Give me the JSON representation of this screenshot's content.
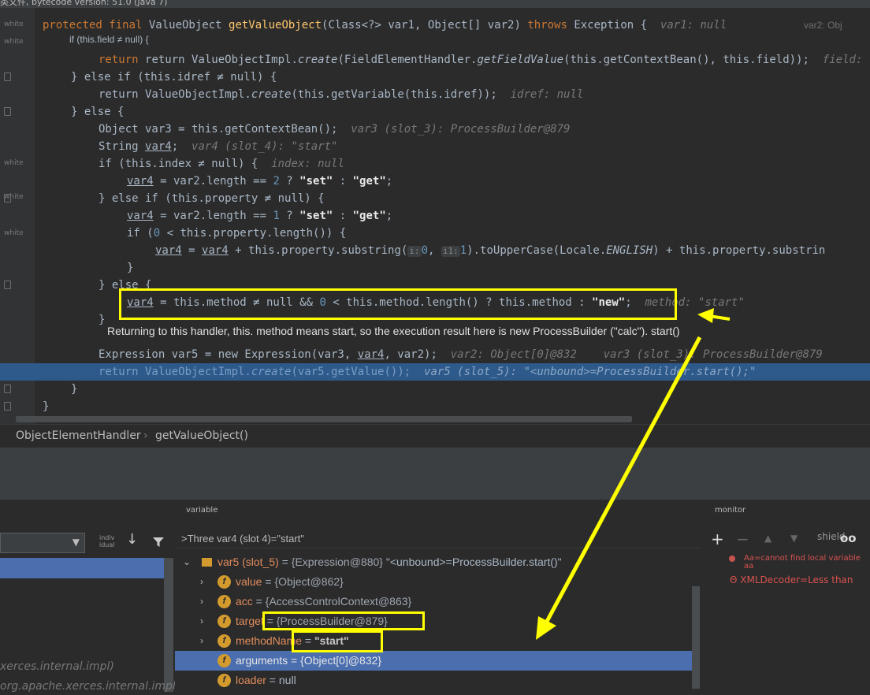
{
  "top_title": "类文件, bytecode version: 51.0 (Java 7)",
  "gutter_labels": [
    "white",
    "white",
    "white",
    "white",
    "white"
  ],
  "code": {
    "sig": {
      "kw1": "protected final ",
      "type": "ValueObject ",
      "fn": "getValueObject",
      "params": "(Class<?> var1, Object[] var2) ",
      "throws": "throws ",
      "exc": "Exception {",
      "hint1": "var1: null",
      "hint2": "var2: Obj"
    },
    "l2": "if (this.field ≠ null) {",
    "l3": {
      "a": "return ValueObjectImpl.",
      "b": "create",
      "c": "(FieldElementHandler.",
      "d": "getFieldValue",
      "e": "(this.getContextBean(), this.field));",
      "hint": "field:"
    },
    "l4": {
      "a": "} else if (this.idref ≠ null) {"
    },
    "l5": {
      "a": "return ValueObjectImpl.",
      "b": "create",
      "c": "(this.getVariable(this.idref));",
      "hint": "idref: null"
    },
    "l6": "} else {",
    "l7": {
      "a": "Object var3 = this.getContextBean();",
      "hint": "var3 (slot_3): ProcessBuilder@879"
    },
    "l8": {
      "a": "String ",
      "b": "var4",
      ";": ";",
      "hint": "var4 (slot_4): \"start\""
    },
    "l9": {
      "a": "if (this.index ≠ null) {",
      "hint": "index: null"
    },
    "l10": {
      "v": "var4",
      "a": " = var2.length == ",
      "n": "2",
      "b": " ? ",
      "s1": "\"set\"",
      "c": " : ",
      "s2": "\"get\"",
      "d": ";"
    },
    "l11": {
      "a": "} else if (this.property ≠ null) {"
    },
    "l12": {
      "v": "var4",
      "a": " = var2.length == ",
      "n": "1",
      "b": " ? ",
      "s1": "\"set\"",
      "c": " : ",
      "s2": "\"get\"",
      "d": ";"
    },
    "l13": {
      "a": "if (",
      "n": "0",
      "b": " < this.property.length()) {"
    },
    "l14": {
      "v1": "var4",
      "a": " = ",
      "v2": "var4",
      "b": " + this.property.substring(",
      "p1": "i:",
      "n1": "0",
      ",": ", ",
      "p2": "i1:",
      "n2": "1",
      "c": ").toUpperCase(Locale.",
      "e": "ENGLISH",
      "d": ") + this.property.substrin"
    },
    "l15": "}",
    "l16": "} else {",
    "l17": {
      "v": "var4",
      "a": " = this.method ≠ null && ",
      "n": "0",
      "b": " < this.method.length() ? this.method : ",
      "s": "\"new\"",
      "c": ";",
      "hint": "method: \"start\""
    },
    "l18": "}",
    "l19": {
      "a": "Expression var5 = new Expression(var3, ",
      "v": "var4",
      ",": ", var2);",
      "hint": "var2: Object[0]@832    var3 (slot_3): ProcessBuilder@879"
    },
    "l20": {
      "a": "return ValueObjectImpl.",
      "b": "create",
      "c": "(var5.getValue());",
      "hint": "var5 (slot_5): \"<unbound>=ProcessBuilder.start();\""
    },
    "l21": "}",
    "l22": "}"
  },
  "annotation": "Returning to this handler, this. method means start, so the execution result here is new ProcessBuilder (\"calc\"). start()",
  "breadcrumb": {
    "class": "ObjectElementHandler",
    "method": "getValueObject()"
  },
  "frames": {
    "partial1": "xerces.internal.impl)",
    "partial2": "org.apache.xerces.internal.impl)",
    "small_label": "indiv idual"
  },
  "variables": {
    "title": "variable",
    "eval": ">Three var4 (slot 4)=\"start\"",
    "rows": [
      {
        "name": "var5 (slot_5)",
        "eq": " = ",
        "val": "{Expression@880}",
        "extra": " \"<unbound>=ProcessBuilder.start()\""
      },
      {
        "name": "value",
        "eq": " = ",
        "val": "{Object@862}"
      },
      {
        "name": "acc",
        "eq": " = ",
        "val": "{AccessControlContext@863}"
      },
      {
        "name": "target",
        "eq": " = ",
        "val": "{ProcessBuilder@879}"
      },
      {
        "name": "methodName",
        "eq": " = ",
        "val": "\"start\""
      },
      {
        "name": "arguments",
        "eq": " = ",
        "val": "{Object[0]@832}"
      },
      {
        "name": "loader",
        "eq": " = ",
        "val": "null"
      }
    ]
  },
  "monitor": {
    "title": "monitor",
    "shield_label": "shield",
    "w1": "Aa=cannot find local variable aa",
    "w2": "Θ XMLDecoder=Less than"
  },
  "colors": {
    "highlight": "#ffff00",
    "current_line": "#2d5a8a",
    "selection": "#4b6eaf",
    "keyword": "#cc7832"
  }
}
